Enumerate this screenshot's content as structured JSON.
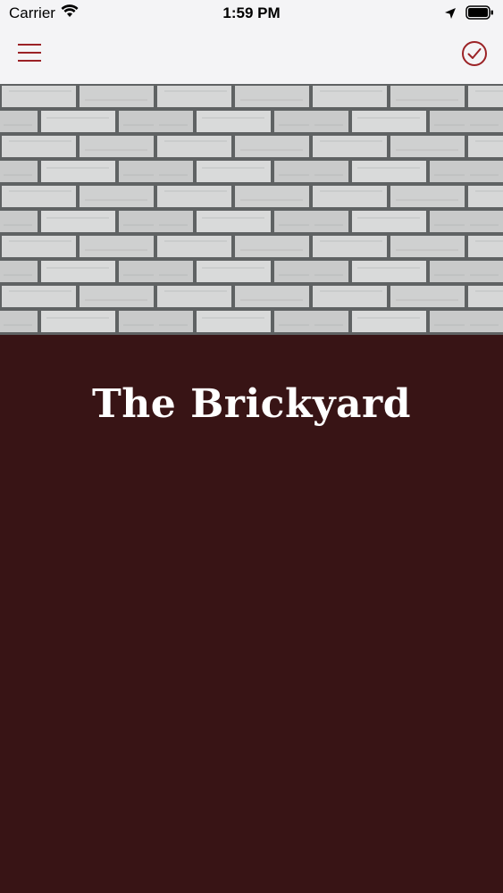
{
  "status_bar": {
    "carrier": "Carrier",
    "time": "1:59 PM",
    "icons": [
      "wifi-icon",
      "location-arrow-icon",
      "battery-icon"
    ]
  },
  "nav_bar": {
    "left_icon": "hamburger-menu-icon",
    "right_icon": "checkmark-circle-icon",
    "accent_color": "#9b2226"
  },
  "hero": {
    "image": "brick-wall-photo"
  },
  "venue": {
    "title": "The Brickyard",
    "background_color": "#381415"
  }
}
